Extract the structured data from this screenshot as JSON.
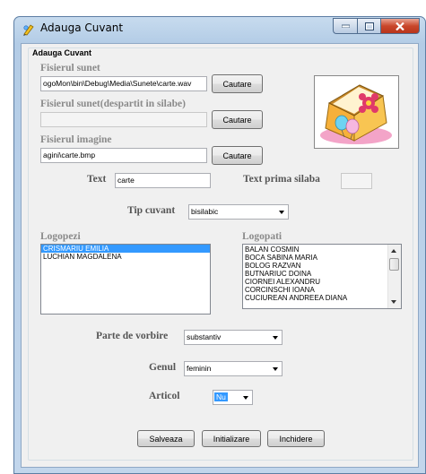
{
  "window": {
    "title": "Adauga Cuvant"
  },
  "group": {
    "label": "Adauga Cuvant"
  },
  "sound": {
    "label": "Fisierul sunet",
    "value": "ogoMon\\bin\\Debug\\Media\\Sunete\\carte.wav",
    "browse_label": "Cautare"
  },
  "sound_split": {
    "label": "Fisierul sunet(despartit in silabe)",
    "value": "",
    "browse_label": "Cautare"
  },
  "image": {
    "label": "Fisierul imagine",
    "value": "agini\\carte.bmp",
    "browse_label": "Cautare"
  },
  "text": {
    "label": "Text",
    "value": "carte"
  },
  "first_syllable": {
    "label": "Text prima silaba",
    "value": ""
  },
  "word_type": {
    "label": "Tip cuvant",
    "value": "bisilabic"
  },
  "speech_therapists_children": {
    "label": "Logopezi",
    "items": [
      "CRISMARIU EMILIA",
      "LUCHIAN MAGDALENA"
    ],
    "selected_index": 0
  },
  "speech_therapists": {
    "label": "Logopati",
    "items": [
      "BALAN  COSMIN",
      "BOCA SABINA MARIA",
      "BOLOG RAZVAN",
      "BUTNARIUC DOINA",
      "CIORNEI ALEXANDRU",
      "CORCINSCHI IOANA",
      "CUCIUREAN ANDREEA DIANA"
    ]
  },
  "part_of_speech": {
    "label": "Parte de vorbire",
    "value": "substantiv"
  },
  "gender": {
    "label": "Genul",
    "value": "feminin"
  },
  "article": {
    "label": "Articol",
    "value": "Nu"
  },
  "buttons": {
    "save": "Salveaza",
    "reset": "Initializare",
    "close": "Inchidere"
  },
  "colors": {
    "selection": "#3399ff",
    "window_frame": "#b9d1ea",
    "close_button": "#c9462b"
  }
}
